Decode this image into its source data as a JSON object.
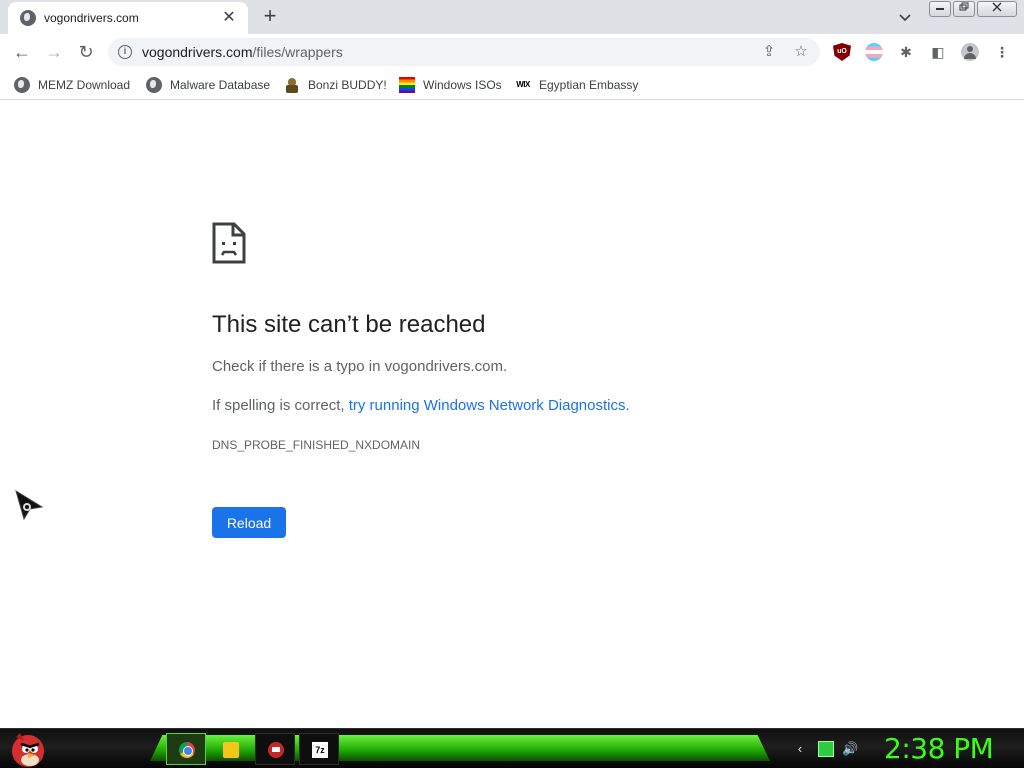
{
  "tab": {
    "title": "vogondrivers.com",
    "close_glyph": "✕",
    "favicon": "globe-icon"
  },
  "newtab_glyph": "+",
  "toolbar": {
    "back_glyph": "←",
    "forward_glyph": "→",
    "reload_glyph": "↻",
    "url_host": "vogondrivers.com",
    "url_path": "/files/wrappers",
    "share_glyph": "⇪",
    "star_glyph": "☆",
    "ublock_text": "uO",
    "puzzle_glyph": "✱",
    "sidepanel_glyph": "◧",
    "menu_glyph": "⋮"
  },
  "bookmarks": [
    {
      "label": "MEMZ Download",
      "icon": "globe-icon"
    },
    {
      "label": "Malware Database",
      "icon": "globe-icon"
    },
    {
      "label": "Bonzi BUDDY!",
      "icon": "bonzi-icon"
    },
    {
      "label": "Windows ISOs",
      "icon": "rainbow-flag-icon"
    },
    {
      "label": "Egyptian Embassy",
      "icon": "wix-icon",
      "icon_text": "WIX"
    }
  ],
  "error": {
    "title": "This site can’t be reached",
    "line1": "Check if there is a typo in vogondrivers.com.",
    "line2_prefix": "If spelling is correct, ",
    "line2_link": "try running Windows Network Diagnostics",
    "line2_suffix": ".",
    "code": "DNS_PROBE_FINISHED_NXDOMAIN",
    "reload_label": "Reload"
  },
  "taskbar": {
    "apps": [
      "chrome-icon",
      "folder-icon",
      "app-icon",
      "7zip-icon"
    ],
    "sevenzip_text": "7z",
    "clock": "2:38 PM"
  },
  "colors": {
    "link": "#1a73e8",
    "reload_button": "#1a73e8",
    "clock": "#39ff14"
  }
}
